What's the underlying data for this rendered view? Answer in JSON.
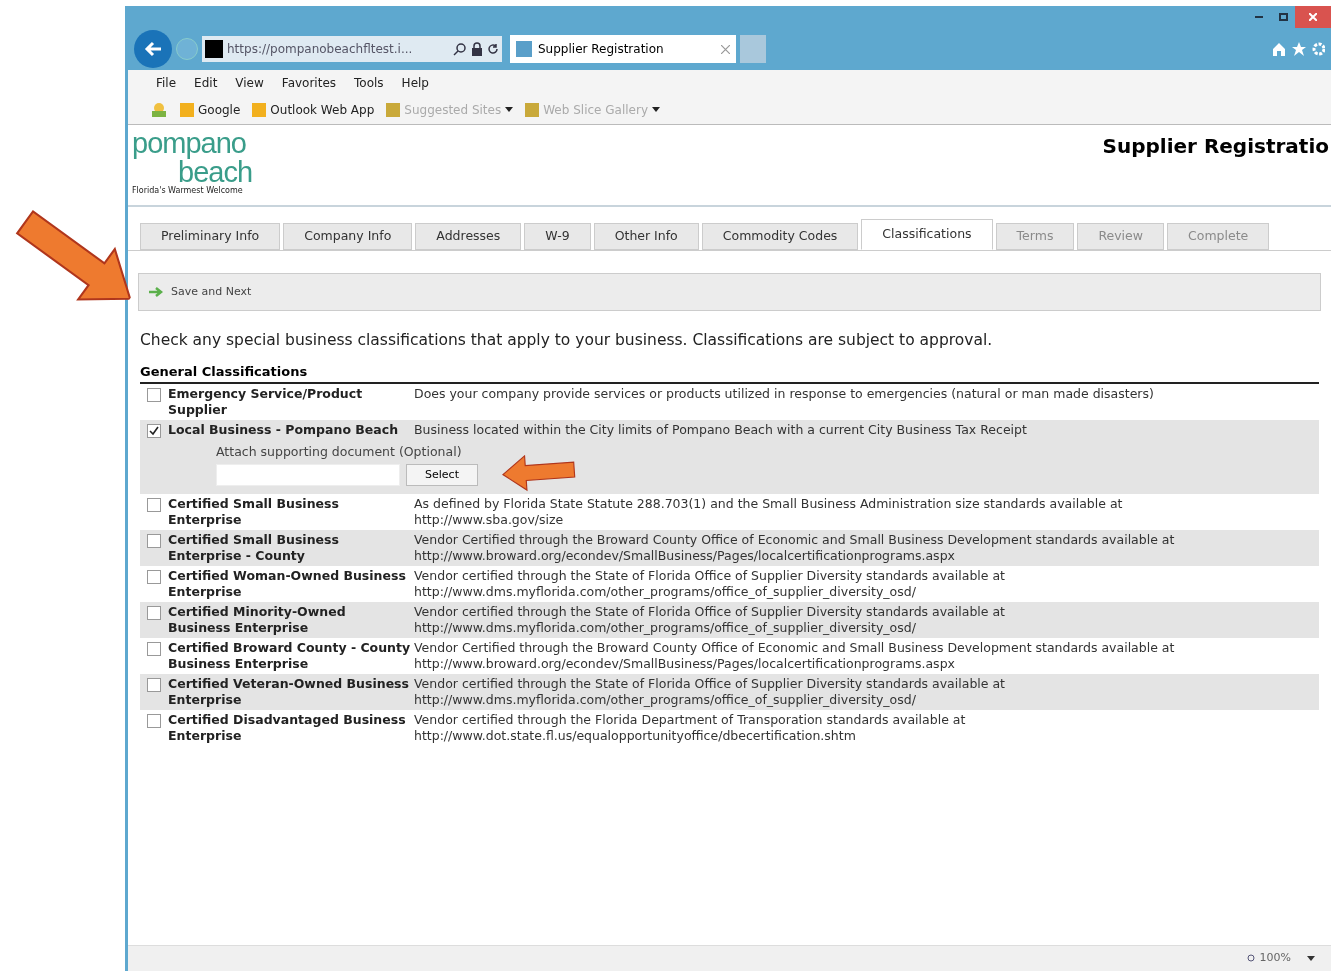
{
  "browser": {
    "address": "https://pompanobeachfltest.i...",
    "tab_title": "Supplier Registration",
    "menu": [
      "File",
      "Edit",
      "View",
      "Favorites",
      "Tools",
      "Help"
    ],
    "favorites": [
      {
        "label": "Google",
        "disabled": false,
        "dropdown": false
      },
      {
        "label": "Outlook Web App",
        "disabled": false,
        "dropdown": false
      },
      {
        "label": "Suggested Sites",
        "disabled": true,
        "dropdown": true
      },
      {
        "label": "Web Slice Gallery",
        "disabled": true,
        "dropdown": true
      }
    ],
    "zoom": "100%"
  },
  "logo": {
    "line1": "pompano",
    "line2": "beach",
    "tagline": "Florida's Warmest Welcome"
  },
  "page_title": "Supplier Registratio",
  "tabs": [
    {
      "label": "Preliminary Info",
      "selected": false,
      "disabled": false
    },
    {
      "label": "Company Info",
      "selected": false,
      "disabled": false
    },
    {
      "label": "Addresses",
      "selected": false,
      "disabled": false
    },
    {
      "label": "W-9",
      "selected": false,
      "disabled": false
    },
    {
      "label": "Other Info",
      "selected": false,
      "disabled": false
    },
    {
      "label": "Commodity Codes",
      "selected": false,
      "disabled": false
    },
    {
      "label": "Classifications",
      "selected": true,
      "disabled": false
    },
    {
      "label": "Terms",
      "selected": false,
      "disabled": true
    },
    {
      "label": "Review",
      "selected": false,
      "disabled": true
    },
    {
      "label": "Complete",
      "selected": false,
      "disabled": true
    }
  ],
  "toolbar": {
    "save_button": "Save and Next"
  },
  "intro": "Check any special business classifications that apply to your business. Classifications are subject to approval.",
  "section_title": "General Classifications",
  "classifications": [
    {
      "name": "Emergency Service/Product Supplier",
      "description": "Does your company provide services or products utilized in response to emergencies (natural or man made disasters)",
      "checked": false
    },
    {
      "name": "Local Business - Pompano Beach",
      "description": "Business located within the City limits of Pompano Beach with a current City Business Tax Receipt",
      "checked": true,
      "attachment": {
        "label": "Attach supporting document (Optional)",
        "button": "Select"
      }
    },
    {
      "name": "Certified Small Business Enterprise",
      "description": "As defined by Florida State Statute 288.703(1) and the Small Business Administration size standards available at",
      "url": "http://www.sba.gov/size",
      "checked": false
    },
    {
      "name": "Certified Small Business Enterprise - County",
      "description": "Vendor Certified through the Broward County Office of Economic and Small Business Development standards available at",
      "url": "http://www.broward.org/econdev/SmallBusiness/Pages/localcertificationprograms.aspx",
      "checked": false
    },
    {
      "name": "Certified Woman-Owned Business Enterprise",
      "description": "Vendor certified through the State of Florida Office of Supplier Diversity standards available at",
      "url": "http://www.dms.myflorida.com/other_programs/office_of_supplier_diversity_osd/",
      "checked": false
    },
    {
      "name": "Certified Minority-Owned Business Enterprise",
      "description": "Vendor certified through the State of Florida Office of Supplier Diversity standards available at",
      "url": "http://www.dms.myflorida.com/other_programs/office_of_supplier_diversity_osd/",
      "checked": false
    },
    {
      "name": "Certified Broward County - County Business Enterprise",
      "description": "Vendor Certified through the Broward County Office of Economic and Small Business Development standards available at",
      "url": "http://www.broward.org/econdev/SmallBusiness/Pages/localcertificationprograms.aspx",
      "checked": false
    },
    {
      "name": "Certified Veteran-Owned Business Enterprise",
      "description": "Vendor certified through the State of Florida Office of Supplier Diversity standards available at",
      "url": "http://www.dms.myflorida.com/other_programs/office_of_supplier_diversity_osd/",
      "checked": false
    },
    {
      "name": "Certified Disadvantaged Business Enterprise",
      "description": "Vendor certified through the Florida Department of Transporation standards available at",
      "url": "http://www.dot.state.fl.us/equalopportunityoffice/dbecertification.shtm",
      "checked": false
    }
  ]
}
